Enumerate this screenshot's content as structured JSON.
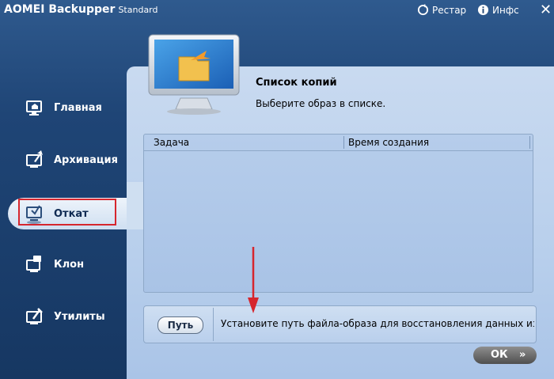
{
  "window": {
    "app_name": "AOMEI Backupper",
    "edition": "Standard",
    "restore_label": "Рестар",
    "info_label": "Инфс",
    "close_glyph": "✕"
  },
  "sidebar": {
    "items": [
      {
        "label": "Главная",
        "icon": "home-monitor-icon"
      },
      {
        "label": "Архивация",
        "icon": "backup-icon"
      },
      {
        "label": "Откат",
        "icon": "restore-icon",
        "active": true
      },
      {
        "label": "Клон",
        "icon": "clone-icon"
      },
      {
        "label": "Утилиты",
        "icon": "tools-icon"
      }
    ]
  },
  "panel": {
    "title": "Список копий",
    "subtitle": "Выберите образ в списке.",
    "columns": [
      "Задача",
      "Время создания"
    ],
    "rows": [],
    "path_button": "Путь",
    "path_text": "Установите путь файла-образа для восстановления данных из фай",
    "ok_button": "ОК",
    "ok_chevron": "»"
  },
  "colors": {
    "highlight_border": "#d6262e",
    "annotation_arrow": "#d6262e"
  }
}
